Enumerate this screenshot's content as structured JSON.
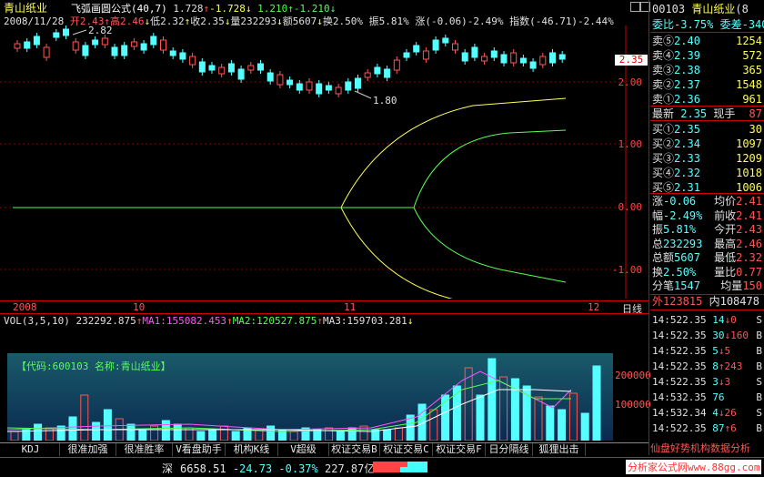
{
  "header": {
    "stock_name": "青山纸业",
    "formula_name": "飞弧画圆公式",
    "formula_params": "(40,7)",
    "v1": "1.728",
    "v2": "-1.728",
    "v3": "1.210",
    "v4": "-1.210"
  },
  "info_row": {
    "date": "2008/11/28",
    "open": "开2.43",
    "high": "高2.46",
    "low": "低2.32",
    "close": "收2.35",
    "volume": "量232293",
    "amount": "额5607",
    "turnover": "换2.50%",
    "amplitude": "振5.81%",
    "change": "涨(-0.06)-2.49%",
    "index": "指数(-46.71)-2.44%"
  },
  "price_labels": {
    "high_mark": "2.82",
    "low_mark": "1.80",
    "current": "2.35"
  },
  "y_axis": [
    "2.00",
    "1.00",
    "0.00",
    "-1.00"
  ],
  "x_axis": [
    "2008",
    "10",
    "11",
    "12"
  ],
  "period_label": "日线",
  "vol_header": {
    "label": "VOL(3,5,10)",
    "vol": "232292.875",
    "ma1": "MA1:155082.453",
    "ma2": "MA2:120527.875",
    "ma3": "MA3:159703.281"
  },
  "vol_box_text": "【代码:600103 名称:青山纸业】",
  "vol_axis": [
    "200000",
    "100000"
  ],
  "bottom_tabs": [
    "KDJ",
    "很准加强",
    "很准胜率",
    "V看盘助手",
    "机构K线(修",
    "V超级MACD",
    "权证交易B",
    "权证交易C",
    "权证交易F",
    "日分隔线",
    "狐狸出击"
  ],
  "sidebar": {
    "code": "00103",
    "name": "青山纸业",
    "name_suffix": "(8",
    "ratio": "委比-3.75%",
    "diff": "委差-340",
    "sells": [
      {
        "label": "卖⑤",
        "price": "2.40",
        "vol": "1254"
      },
      {
        "label": "卖④",
        "price": "2.39",
        "vol": "572"
      },
      {
        "label": "卖③",
        "price": "2.38",
        "vol": "365"
      },
      {
        "label": "卖②",
        "price": "2.37",
        "vol": "1548"
      },
      {
        "label": "卖①",
        "price": "2.36",
        "vol": "961"
      }
    ],
    "last": {
      "label": "最新",
      "price": "2.35",
      "vol_label": "现手",
      "vol": "87"
    },
    "buys": [
      {
        "label": "买①",
        "price": "2.35",
        "vol": "30"
      },
      {
        "label": "买②",
        "price": "2.34",
        "vol": "1097"
      },
      {
        "label": "买③",
        "price": "2.33",
        "vol": "1209"
      },
      {
        "label": "买④",
        "price": "2.32",
        "vol": "1018"
      },
      {
        "label": "买⑤",
        "price": "2.31",
        "vol": "1006"
      }
    ],
    "stats": [
      {
        "k1": "涨",
        "v1": "-0.06",
        "k2": "均价",
        "v2": "2.41"
      },
      {
        "k1": "幅",
        "v1": "-2.49%",
        "k2": "前收",
        "v2": "2.41"
      },
      {
        "k1": "振",
        "v1": "5.81%",
        "k2": "今开",
        "v2": "2.43"
      },
      {
        "k1": "总",
        "v1": "232293",
        "k2": "最高",
        "v2": "2.46"
      },
      {
        "k1": "总额",
        "v1": "5607",
        "k2": "最低",
        "v2": "2.32"
      },
      {
        "k1": "换",
        "v1": "2.50%",
        "k2": "量比",
        "v2": "0.77"
      },
      {
        "k1": "分笔",
        "v1": "1547",
        "k2": "均量",
        "v2": "150"
      }
    ],
    "outer": "外123815",
    "inner": "内108478",
    "ticks": [
      {
        "time": "14:52",
        "price": "2.35",
        "vol": "14",
        "dir": "↓",
        "bs": "0",
        "side": "S"
      },
      {
        "time": "14:52",
        "price": "2.35",
        "vol": "30",
        "dir": "↓",
        "bs": "160",
        "side": "B"
      },
      {
        "time": "14:52",
        "price": "2.35",
        "vol": "5",
        "dir": "↓",
        "bs": "5",
        "side": "B"
      },
      {
        "time": "14:52",
        "price": "2.35",
        "vol": "8",
        "dir": "↑",
        "bs": "243",
        "side": "B"
      },
      {
        "time": "14:52",
        "price": "2.35",
        "vol": "3",
        "dir": "↓",
        "bs": "3",
        "side": "S"
      },
      {
        "time": "14:53",
        "price": "2.35",
        "vol": "76",
        "dir": "",
        "bs": "",
        "side": "B"
      },
      {
        "time": "14:53",
        "price": "2.34",
        "vol": "4",
        "dir": "↓",
        "bs": "26",
        "side": "S"
      },
      {
        "time": "14:52",
        "price": "2.35",
        "vol": "87",
        "dir": "↑",
        "bs": "6",
        "side": "B"
      }
    ],
    "footer": "仙盘好势机构数据分析"
  },
  "status": {
    "market": "深",
    "index": "6658.51",
    "change": "-24.73",
    "pct": "-0.37%",
    "amount": "227.87亿",
    "watermark": "分析家公式网www.88gg.com"
  },
  "colors": {
    "up": "#ff5555",
    "down": "#55ffff",
    "ma1": "#ff55ff",
    "ma2": "#55ff55",
    "ma3": "#ffffff",
    "arc_yellow": "#ffff55",
    "arc_green": "#55ff55"
  }
}
